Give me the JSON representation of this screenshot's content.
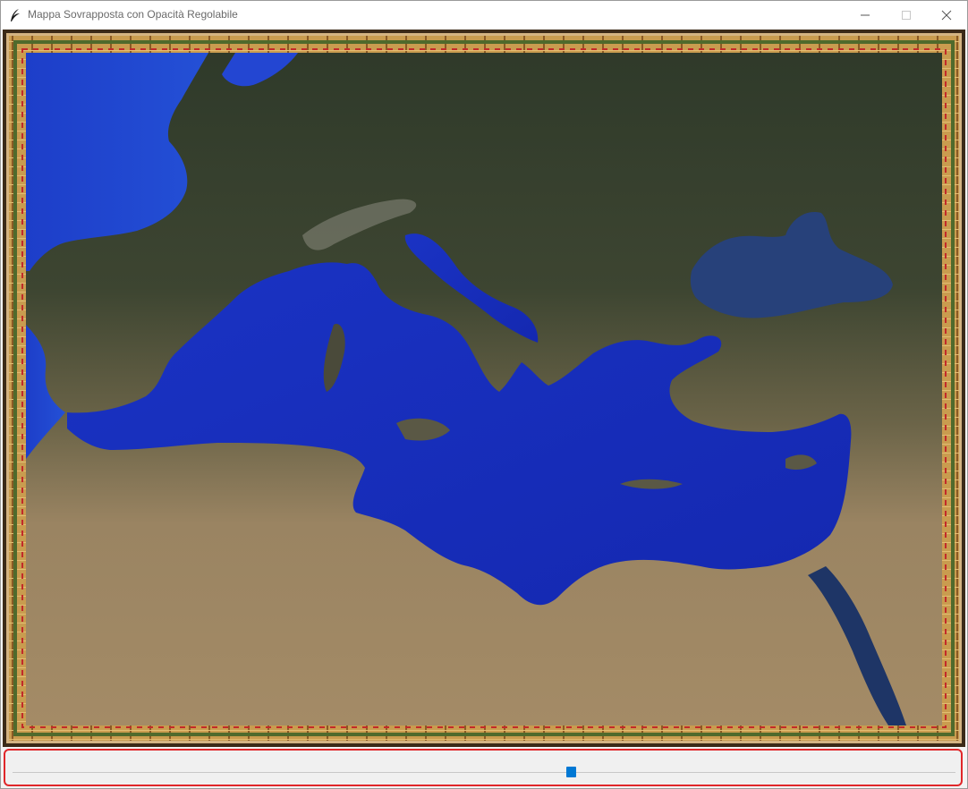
{
  "window": {
    "title": "Mappa Sovrapposta con Opacità Regolabile",
    "icon": "feather-icon",
    "controls": [
      "minimize-icon",
      "maximize-icon",
      "close-icon"
    ]
  },
  "map": {
    "subject": "satellite-map-mediterranean",
    "frame": "decorative-border",
    "colors": {
      "sea": "#1c34c8",
      "black_sea": "#27417a",
      "land_north": "#3c4431",
      "land_south": "#a8906a",
      "frame_gold": "#c99c4f",
      "frame_green": "#4f6a2c",
      "frame_red": "#c22a2a"
    }
  },
  "slider": {
    "label": "opacity-slider",
    "value_fraction": 0.592,
    "accent": "#0078d4",
    "panel_border": "#e0272a"
  }
}
